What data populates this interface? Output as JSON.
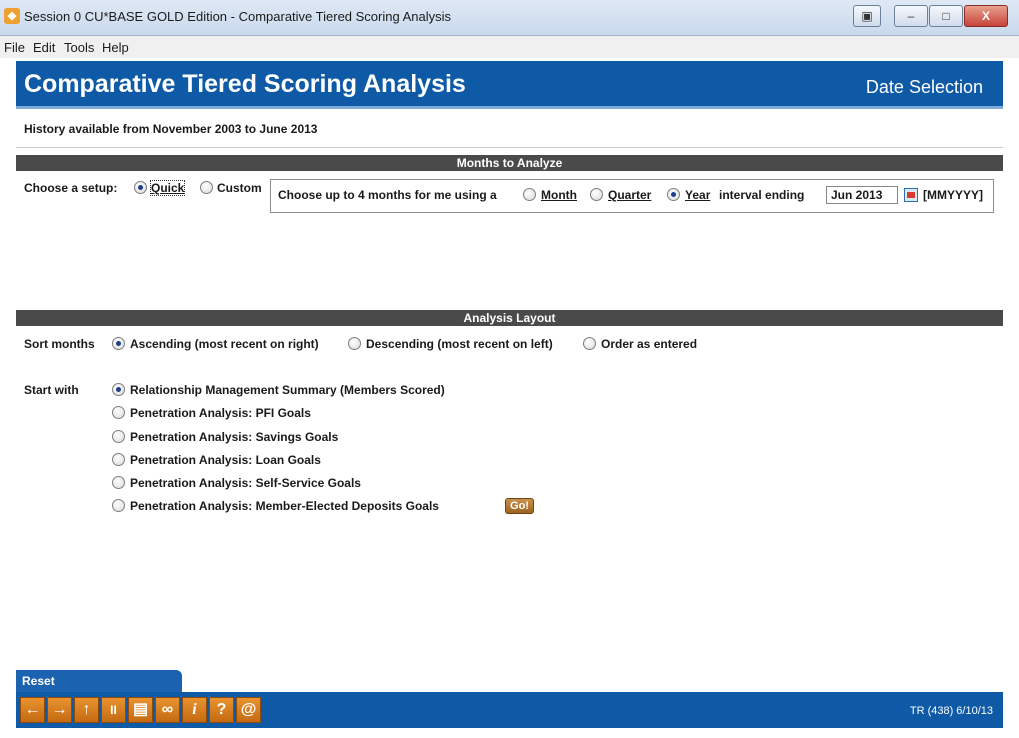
{
  "window": {
    "title": "Session 0 CU*BASE GOLD Edition - Comparative Tiered Scoring Analysis",
    "min_label": "–",
    "max_label": "□",
    "close_label": "X"
  },
  "menu": [
    "File",
    "Edit",
    "Tools",
    "Help"
  ],
  "header": {
    "title": "Comparative Tiered Scoring Analysis",
    "subtitle": "Date Selection"
  },
  "history_text": "History available from November 2003 to June 2013",
  "months_section": {
    "title": "Months to Analyze",
    "setup_label": "Choose a setup:",
    "setup_options": [
      {
        "label": "Quick",
        "selected": true
      },
      {
        "label": "Custom",
        "selected": false
      }
    ],
    "quick_prompt": "Choose up to 4 months for me using a",
    "interval_options": [
      {
        "label": "Month",
        "selected": false
      },
      {
        "label": "Quarter",
        "selected": false
      },
      {
        "label": "Year",
        "selected": true
      }
    ],
    "interval_ending_label": "interval ending",
    "ending_value": "Jun 2013",
    "format_hint": "[MMYYYY]"
  },
  "layout_section": {
    "title": "Analysis Layout",
    "sort_label": "Sort months",
    "sort_options": [
      {
        "label": "Ascending (most recent on right)",
        "selected": true
      },
      {
        "label": "Descending (most recent on left)",
        "selected": false
      },
      {
        "label": "Order as entered",
        "selected": false
      }
    ],
    "start_label": "Start with",
    "start_options": [
      {
        "label": "Relationship Management Summary (Members Scored)",
        "selected": true
      },
      {
        "label": "Penetration Analysis:  PFI Goals",
        "selected": false
      },
      {
        "label": "Penetration Analysis:  Savings Goals",
        "selected": false
      },
      {
        "label": "Penetration Analysis:  Loan Goals",
        "selected": false
      },
      {
        "label": "Penetration Analysis:  Self-Service Goals",
        "selected": false
      },
      {
        "label": "Penetration Analysis:  Member-Elected Deposits Goals",
        "selected": false
      }
    ],
    "go_label": "Go!"
  },
  "footer": {
    "reset_label": "Reset",
    "toolbar_icons": [
      "back-arrow-icon",
      "forward-arrow-icon",
      "up-arrow-icon",
      "pause-icon",
      "print-icon",
      "link-icon",
      "info-icon",
      "help-icon",
      "email-at-icon"
    ],
    "toolbar_glyphs": [
      "←",
      "→",
      "↑",
      "II",
      "▤",
      "∞",
      "i",
      "?",
      "@"
    ],
    "stamp": "TR (438) 6/10/13"
  },
  "colors": {
    "header_blue": "#0e5aa7",
    "section_bar": "#4a4a4a",
    "toolbar_orange": "#e07f22"
  }
}
